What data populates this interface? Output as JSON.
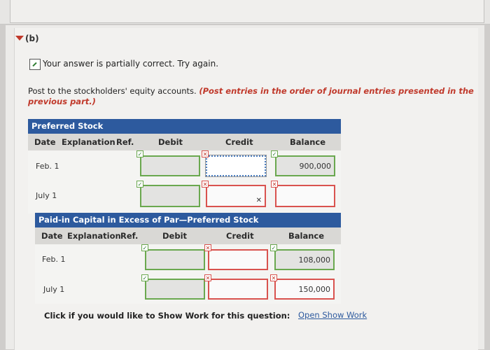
{
  "part": {
    "label": "(b)"
  },
  "status": {
    "text": "Your answer is partially correct.  Try again."
  },
  "instruction": {
    "lead": "Post to the stockholders' equity accounts. ",
    "emphasis": "(Post entries in the order of journal entries presented in the previous part.)"
  },
  "accounts": [
    {
      "title": "Preferred Stock",
      "headers": {
        "date": "Date",
        "explanation": "Explanation",
        "ref": "Ref.",
        "debit": "Debit",
        "credit": "Credit",
        "balance": "Balance"
      },
      "rows": [
        {
          "date": "Feb. 1",
          "debit": "",
          "credit": "",
          "balance": "900,000"
        },
        {
          "date": "July 1",
          "debit": "",
          "credit": "",
          "balance": ""
        }
      ]
    },
    {
      "title": "Paid-in Capital in Excess of Par—Preferred Stock",
      "headers": {
        "date": "Date",
        "explanation": "Explanation",
        "ref": "Ref.",
        "debit": "Debit",
        "credit": "Credit",
        "balance": "Balance"
      },
      "rows": [
        {
          "date": "Feb. 1",
          "debit": "",
          "credit": "",
          "balance": "108,000"
        },
        {
          "date": "July 1",
          "debit": "",
          "credit": "",
          "balance": "150,000"
        }
      ]
    }
  ],
  "marks": {
    "ok": "✓",
    "bad": "✕"
  },
  "footer": {
    "question": "Click if you would like to Show Work for this question:",
    "link": "Open Show Work"
  },
  "colors": {
    "header_blue": "#2d5a9e",
    "correct": "#6aa84f",
    "incorrect": "#d9534f",
    "emphasis": "#c0392b"
  }
}
